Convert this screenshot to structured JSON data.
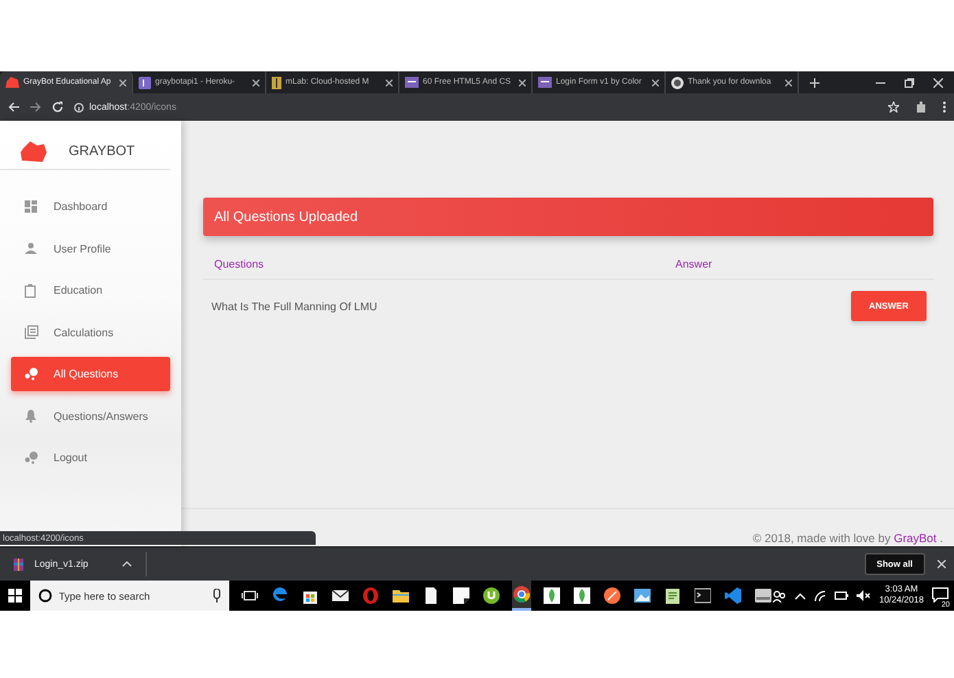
{
  "browser": {
    "tabs": [
      {
        "title": "GrayBot Educational Ap",
        "selected": true
      },
      {
        "title": "graybotapi1 - Heroku-",
        "selected": false
      },
      {
        "title": "mLab: Cloud-hosted M",
        "selected": false
      },
      {
        "title": "60 Free HTML5 And CS",
        "selected": false
      },
      {
        "title": "Login Form v1 by Color",
        "selected": false
      },
      {
        "title": "Thank you for downloa",
        "selected": false
      }
    ],
    "url_host": "localhost",
    "url_path": ":4200/icons"
  },
  "sidebar": {
    "brand": "GRAYBOT",
    "items": [
      {
        "label": "Dashboard",
        "selected": false
      },
      {
        "label": "User Profile",
        "selected": false
      },
      {
        "label": "Education",
        "selected": false
      },
      {
        "label": "Calculations",
        "selected": false
      },
      {
        "label": "All Questions",
        "selected": true
      },
      {
        "label": "Questions/Answers",
        "selected": false
      },
      {
        "label": "Logout",
        "selected": false
      }
    ]
  },
  "card": {
    "title": "All Questions Uploaded",
    "columns": [
      "Questions",
      "Answer"
    ],
    "rows": [
      {
        "question": "What Is The Full Manning Of LMU",
        "action": "ANSWER"
      }
    ]
  },
  "footer": {
    "text": "© 2018, made with love by",
    "link": "GrayBot",
    "end": "."
  },
  "status_url": "localhost:4200/icons",
  "downloads": {
    "file": "Login_v1.zip",
    "show_all": "Show all"
  },
  "taskbar": {
    "search_placeholder": "Type here to search",
    "time": "3:03 AM",
    "date": "10/24/2018",
    "notifications": "20",
    "apps": [
      {
        "kind": "taskview",
        "selected": false
      },
      {
        "kind": "edge",
        "selected": false
      },
      {
        "kind": "store",
        "selected": false
      },
      {
        "kind": "mail",
        "selected": false
      },
      {
        "kind": "opera",
        "selected": false
      },
      {
        "kind": "folder",
        "selected": false
      },
      {
        "kind": "file",
        "selected": false
      },
      {
        "kind": "notes",
        "selected": false
      },
      {
        "kind": "torrent",
        "selected": false
      },
      {
        "kind": "chrome",
        "selected": true
      },
      {
        "kind": "leaf",
        "selected": false
      },
      {
        "kind": "leaf",
        "selected": false
      },
      {
        "kind": "compass",
        "selected": false
      },
      {
        "kind": "photo",
        "selected": false
      },
      {
        "kind": "editor",
        "selected": false
      },
      {
        "kind": "terminal",
        "selected": false
      },
      {
        "kind": "vscode",
        "selected": false
      },
      {
        "kind": "drive",
        "selected": false
      }
    ]
  }
}
